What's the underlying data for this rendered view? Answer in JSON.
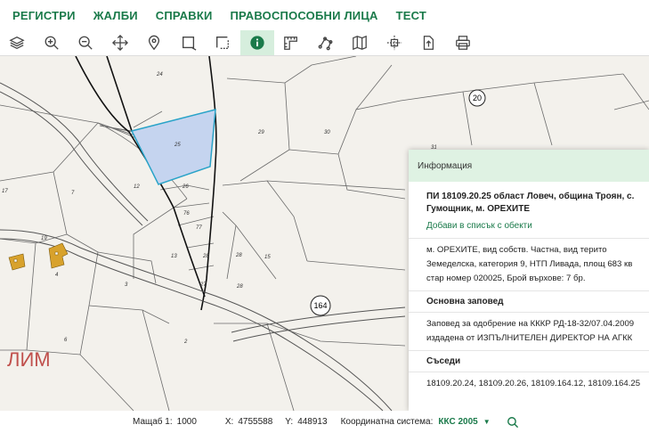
{
  "menu": [
    "РЕГИСТРИ",
    "ЖАЛБИ",
    "СПРАВКИ",
    "ПРАВОСПОСОБНИ ЛИЦА",
    "ТЕСТ"
  ],
  "toolbar": [
    {
      "name": "layers-icon"
    },
    {
      "name": "zoom-in-icon"
    },
    {
      "name": "zoom-out-icon"
    },
    {
      "name": "pan-icon"
    },
    {
      "name": "location-pin-icon"
    },
    {
      "name": "select-rectangle-icon"
    },
    {
      "name": "select-area-icon"
    },
    {
      "name": "info-icon",
      "active": true
    },
    {
      "name": "measure-distance-icon"
    },
    {
      "name": "measure-polyline-icon"
    },
    {
      "name": "map-icon"
    },
    {
      "name": "crosshair-icon"
    },
    {
      "name": "export-icon"
    },
    {
      "name": "print-icon"
    }
  ],
  "map": {
    "labels": [
      "24",
      "25",
      "29",
      "30",
      "31",
      "12",
      "26",
      "76",
      "77",
      "13",
      "28",
      "28",
      "15",
      "17",
      "7",
      "19",
      "4",
      "3",
      "6",
      "2",
      "27",
      "28"
    ],
    "road_numbers": [
      "20",
      "164"
    ],
    "place_name": "ЛИМ"
  },
  "status": {
    "scale_label": "Мащаб 1:",
    "scale_value": "1000",
    "x_label": "X:",
    "x_value": "4755588",
    "y_label": "Y:",
    "y_value": "448913",
    "crs_label": "Координатна система:",
    "crs_value": "ККС 2005"
  },
  "info": {
    "header": "Информация",
    "title_line1": "ПИ 18109.20.25 област Ловеч, община Троян, с.",
    "title_line2": "Гумощник, м. ОРЕХИТЕ",
    "add_link": "Добави в списък с обекти",
    "desc_line1": "м.  ОРЕХИТЕ,  вид  собств.  Частна,  вид  терито",
    "desc_line2": "Земеделска, категория 9, НТП Ливада, площ 683 кв",
    "desc_line3": "стар номер 020025, Брой върхове: 7 бр.",
    "order_title": "Основна заповед",
    "order_line1": "Заповед  за  одобрение  на  КККР  РД-18-32/07.04.2009",
    "order_line2": "издадена от ИЗПЪЛНИТЕЛЕН ДИРЕКТОР НА АГКК",
    "neighbors_title": "Съседи",
    "neighbors_text": "18109.20.24, 18109.20.26, 18109.164.12, 18109.164.25"
  },
  "colors": {
    "accent": "#1a7a4a",
    "selected_fill": "#c5d4ef",
    "selected_stroke": "#29a3c8",
    "building_fill": "#d8a22c"
  }
}
